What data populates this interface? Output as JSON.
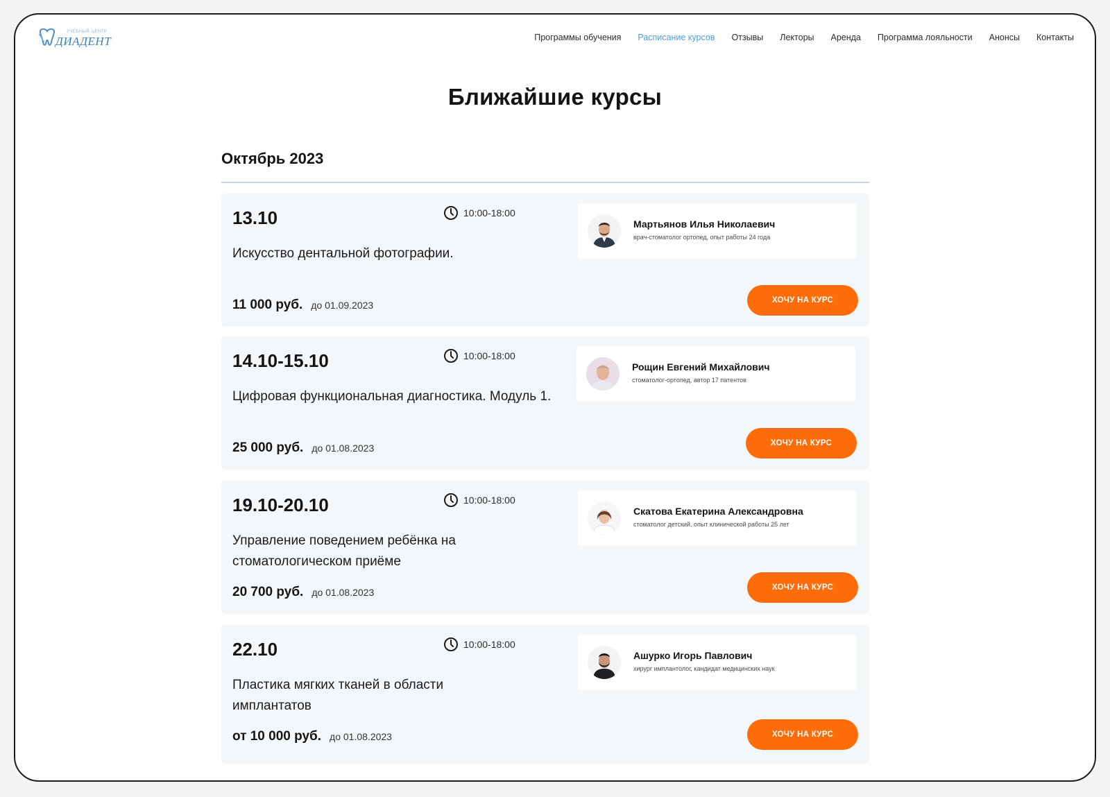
{
  "brand": {
    "small": "УЧЕБНЫЙ ЦЕНТР",
    "name": "ДИАДЕНТ"
  },
  "nav": {
    "items": [
      {
        "label": "Программы обучения",
        "active": false
      },
      {
        "label": "Расписание курсов",
        "active": true
      },
      {
        "label": "Отзывы",
        "active": false
      },
      {
        "label": "Лекторы",
        "active": false
      },
      {
        "label": "Аренда",
        "active": false
      },
      {
        "label": "Программа лояльности",
        "active": false
      },
      {
        "label": "Анонсы",
        "active": false
      },
      {
        "label": "Контакты",
        "active": false
      }
    ]
  },
  "page": {
    "title": "Ближайшие курсы",
    "month": "Октябрь 2023"
  },
  "courses": [
    {
      "date": "13.10",
      "time": "10:00-18:00",
      "title": "Искусство дентальной фотографии.",
      "price": "11 000 руб.",
      "deadline": "до 01.09.2023",
      "lecturer": {
        "name": "Мартьянов Илья Николаевич",
        "role": "врач-стоматолог ортопед, опыт работы 24 года"
      },
      "cta": "ХОЧУ НА КУРС"
    },
    {
      "date": "14.10-15.10",
      "time": "10:00-18:00",
      "title": "Цифровая функциональная диагностика. Модуль 1.",
      "price": "25 000 руб.",
      "deadline": "до 01.08.2023",
      "lecturer": {
        "name": "Рощин Евгений Михайлович",
        "role": "стоматолог-ортопед, автор 17 патентов"
      },
      "cta": "ХОЧУ НА КУРС"
    },
    {
      "date": "19.10-20.10",
      "time": "10:00-18:00",
      "title": "Управление поведением ребёнка на стоматологическом приёме",
      "price": "20 700 руб.",
      "deadline": "до 01.08.2023",
      "lecturer": {
        "name": "Скатова Екатерина Александровна",
        "role": "стоматолог детский, опыт клинической работы 25 лет"
      },
      "cta": "ХОЧУ НА КУРС"
    },
    {
      "date": "22.10",
      "time": "10:00-18:00",
      "title": "Пластика мягких тканей в области имплантатов",
      "price": "от 10 000 руб.",
      "deadline": "до 01.08.2023",
      "lecturer": {
        "name": "Ашурко Игорь Павлович",
        "role": "хирург имплантолог, кандидат медицинских наук"
      },
      "cta": "ХОЧУ НА КУРС"
    }
  ],
  "colors": {
    "accent": "#ff6d0a",
    "nav_active": "#4a9fd6",
    "card_bg": "#f3f7fa"
  }
}
